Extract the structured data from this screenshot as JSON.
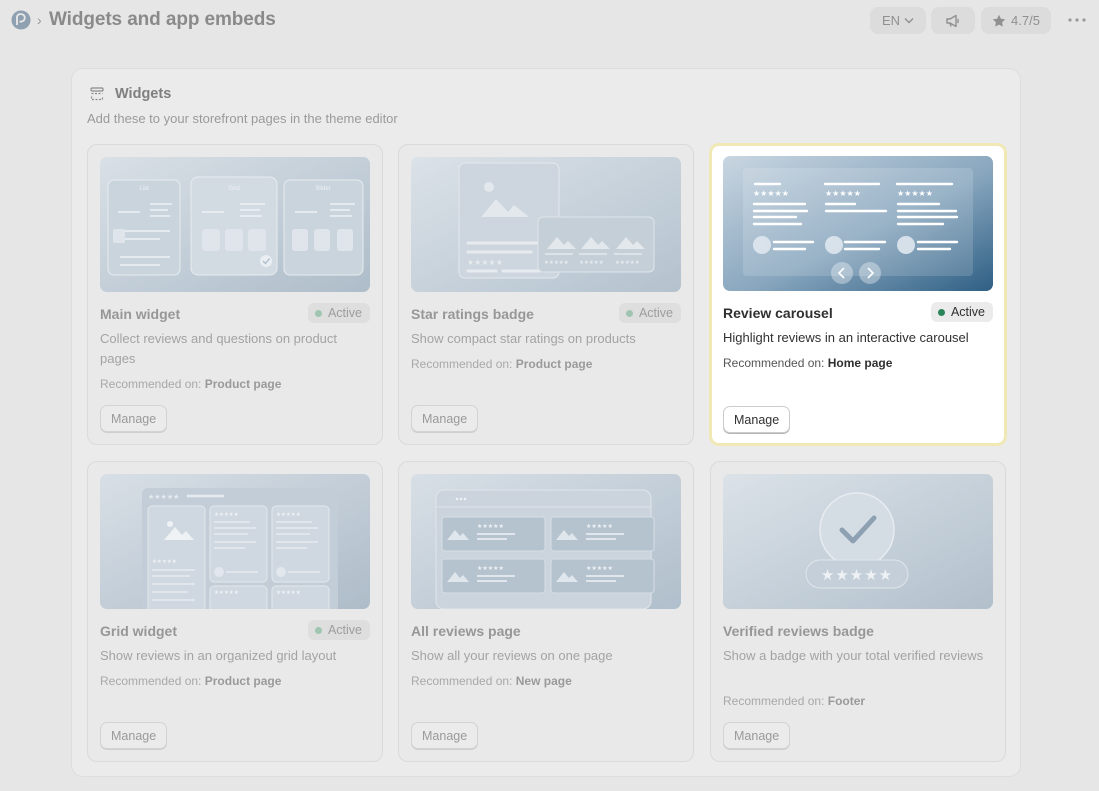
{
  "header": {
    "page_title": "Widgets and app embeds",
    "breadcrumb_separator": "›",
    "language": "EN",
    "rating": "4.7/5"
  },
  "widgets": {
    "title": "Widgets",
    "subtitle": "Add these to your storefront pages in the theme editor",
    "recommended_prefix": "Recommended on:",
    "manage_label": "Manage",
    "cards": [
      {
        "title": "Main widget",
        "status": "Active",
        "description": "Collect reviews and questions on product pages",
        "recommended": "Product page",
        "preview_tabs": [
          "List",
          "Grid",
          "Slider"
        ]
      },
      {
        "title": "Star ratings badge",
        "status": "Active",
        "description": "Show compact star ratings on products",
        "recommended": "Product page"
      },
      {
        "title": "Review carousel",
        "status": "Active",
        "description": "Highlight reviews in an interactive carousel",
        "recommended": "Home page"
      },
      {
        "title": "Grid widget",
        "status": "Active",
        "description": "Show reviews in an organized grid layout",
        "recommended": "Product page"
      },
      {
        "title": "All reviews page",
        "status": "",
        "description": "Show all your reviews on one page",
        "recommended": "New page"
      },
      {
        "title": "Verified reviews badge",
        "status": "",
        "description": "Show a badge with your total verified reviews",
        "recommended": "Footer"
      }
    ]
  },
  "colors": {
    "page_bg": "#e6e6e6",
    "featured_border": "#f1e9b5",
    "active_dot": "#29845a",
    "carousel_gradient": [
      "#c4d3df",
      "#2e5f84"
    ]
  }
}
